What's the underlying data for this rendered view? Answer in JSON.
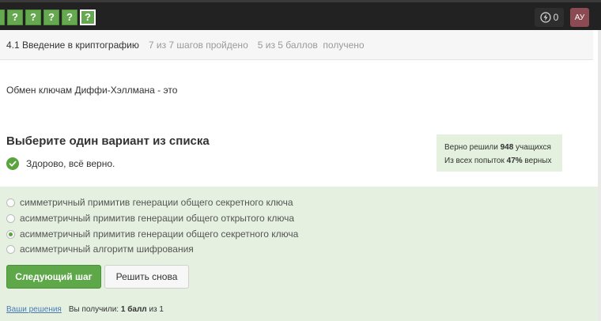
{
  "topbar": {
    "steps": [
      {
        "label": "",
        "state": "first"
      },
      {
        "label": "?",
        "state": "done"
      },
      {
        "label": "?",
        "state": "done"
      },
      {
        "label": "?",
        "state": "done"
      },
      {
        "label": "?",
        "state": "done"
      },
      {
        "label": "?",
        "state": "active"
      }
    ],
    "points": "0",
    "avatar": "АУ"
  },
  "lesson": {
    "title": "4.1 Введение в криптографию",
    "progress": "7 из 7 шагов пройдено",
    "score": "5 из 5 баллов  получено"
  },
  "question": "Обмен ключам Диффи-Хэллмана - это",
  "quiz": {
    "title": "Выберите один вариант из списка",
    "feedback": "Здорово, всё верно.",
    "stats": {
      "solved_prefix": "Верно решили ",
      "solved_count": "948",
      "solved_suffix": " учащихся",
      "attempts_prefix": "Из всех попыток ",
      "attempts_percent": "47%",
      "attempts_suffix": " верных"
    },
    "options": [
      {
        "label": "симметричный примитив генерации общего секретного ключа",
        "checked": false
      },
      {
        "label": "асимметричный примитив генерации общего открытого ключа",
        "checked": false
      },
      {
        "label": "асимметричный примитив генерации общего секретного ключа",
        "checked": true
      },
      {
        "label": "асимметричный алгоритм шифрования",
        "checked": false
      }
    ],
    "next_label": "Следующий шаг",
    "retry_label": "Решить снова"
  },
  "footer": {
    "solutions_link": "Ваши решения",
    "score_prefix": "Вы получили: ",
    "score_value": "1 балл",
    "score_suffix": " из 1"
  },
  "colors": {
    "success": "#5aa43e",
    "answers_bg": "#e5f0e0",
    "stats_bg": "#e3f1de",
    "topbar": "#222222"
  }
}
